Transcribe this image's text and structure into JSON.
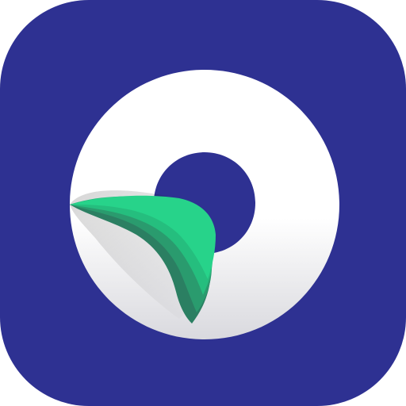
{
  "icon": {
    "name": "app-icon",
    "shape": "rounded-square",
    "emblem": "curled-ring-icon",
    "colors": {
      "background": "#2E3192",
      "ring": "#FFFFFF",
      "ring_shadow": "#D9D9DE",
      "curl_light": "#27D38A",
      "curl_mid": "#25BE7E",
      "curl_dark": "#2A9B6E",
      "curl_deep": "#2B7F62"
    }
  }
}
